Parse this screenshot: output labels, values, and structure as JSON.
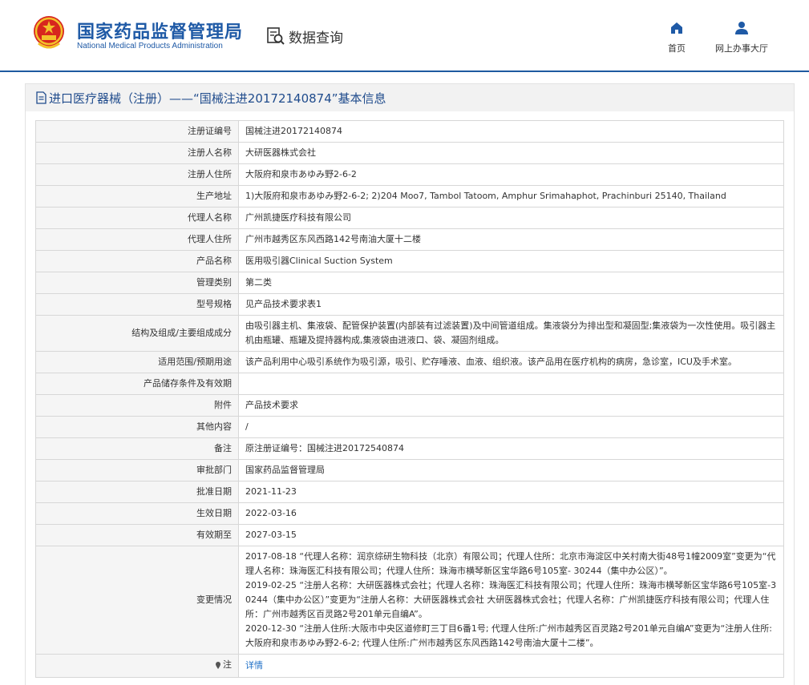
{
  "header": {
    "brand_cn": "国家药品监督管理局",
    "brand_en": "National Medical Products Administration",
    "section_label": "数据查询",
    "nav": [
      {
        "label": "首页",
        "icon": "home-icon"
      },
      {
        "label": "网上办事大厅",
        "icon": "user-icon"
      }
    ],
    "accent_color": "#1f5aa6"
  },
  "panel": {
    "title": "进口医疗器械（注册）——“国械注进20172140874”基本信息",
    "title_icon": "document-icon"
  },
  "rows": [
    {
      "key": "注册证编号",
      "value": "国械注进20172140874"
    },
    {
      "key": "注册人名称",
      "value": "大研医器株式会社"
    },
    {
      "key": "注册人住所",
      "value": "大阪府和泉市あゆみ野2-6-2"
    },
    {
      "key": "生产地址",
      "value": "1)大阪府和泉市あゆみ野2-6-2; 2)204 Moo7, Tambol Tatoom, Amphur Srimahaphot, Prachinburi 25140, Thailand"
    },
    {
      "key": "代理人名称",
      "value": "广州凯捷医疗科技有限公司"
    },
    {
      "key": "代理人住所",
      "value": "广州市越秀区东风西路142号南油大厦十二楼"
    },
    {
      "key": "产品名称",
      "value": "医用吸引器Clinical Suction System"
    },
    {
      "key": "管理类别",
      "value": "第二类"
    },
    {
      "key": "型号规格",
      "value": "见产品技术要求表1"
    },
    {
      "key": "结构及组成/主要组成成分",
      "value": "由吸引器主机、集液袋、配管保护装置(内部装有过滤装置)及中间管道组成。集液袋分为排出型和凝固型;集液袋为一次性使用。吸引器主机由瓶罐、瓶罐及提持器构成,集液袋由进液口、袋、凝固剂组成。"
    },
    {
      "key": "适用范围/预期用途",
      "value": "该产品利用中心吸引系统作为吸引源，吸引、贮存唾液、血液、组织液。该产品用在医疗机构的病房，急诊室，ICU及手术室。"
    },
    {
      "key": "产品储存条件及有效期",
      "value": ""
    },
    {
      "key": "附件",
      "value": "产品技术要求"
    },
    {
      "key": "其他内容",
      "value": "/"
    },
    {
      "key": "备注",
      "value": "原注册证编号：国械注进20172540874"
    },
    {
      "key": "审批部门",
      "value": "国家药品监督管理局"
    },
    {
      "key": "批准日期",
      "value": "2021-11-23"
    },
    {
      "key": "生效日期",
      "value": "2022-03-16"
    },
    {
      "key": "有效期至",
      "value": "2027-03-15"
    }
  ],
  "changes": {
    "key": "变更情况",
    "lines": [
      "2017-08-18 “代理人名称：润京综研生物科技（北京）有限公司；代理人住所：北京市海淀区中关村南大街48号1幢2009室”变更为“代理人名称：珠海医汇科技有限公司；代理人住所：珠海市横琴新区宝华路6号105室- 30244（集中办公区）”。",
      "2019-02-25 “注册人名称：大研医器株式会社；代理人名称：珠海医汇科技有限公司；代理人住所：珠海市横琴新区宝华路6号105室-30244（集中办公区）”变更为“注册人名称：大研医器株式会社 大研医器株式会社；代理人名称：广州凯捷医疗科技有限公司；代理人住所：广州市越秀区百灵路2号201单元自编A”。",
      "2020-12-30 “注册人住所:大阪市中央区道修町三丁目6番1号; 代理人住所:广州市越秀区百灵路2号201单元自编A”变更为“注册人住所:大阪府和泉市あゆみ野2-6-2; 代理人住所:广州市越秀区东风西路142号南油大厦十二楼”。"
    ]
  },
  "note": {
    "key": "注",
    "icon": "pin-icon",
    "link_label": "详情"
  }
}
